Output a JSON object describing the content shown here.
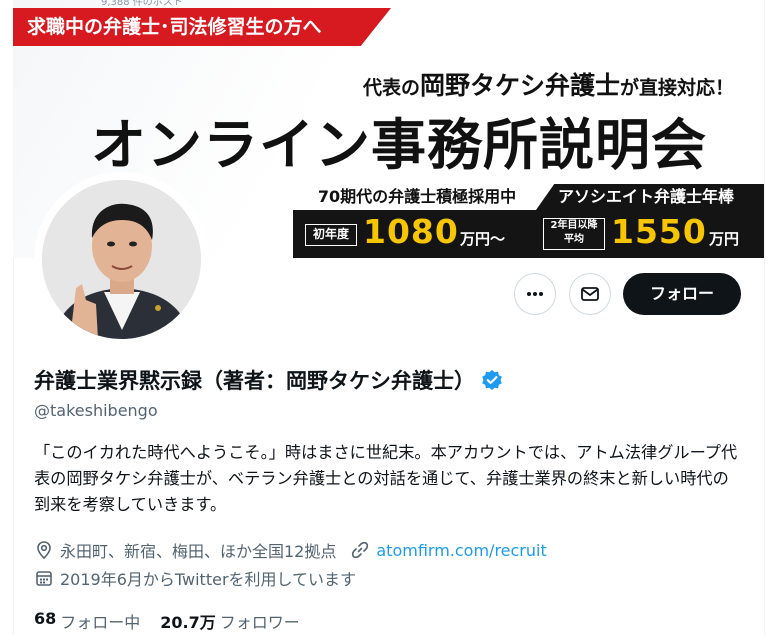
{
  "banner": {
    "cropped_top_text": "9,388 件のポスト",
    "red_tag": "求職中の弁護士･司法修習生の方へ",
    "direct_line_prefix": "代表の",
    "direct_line_name": "岡野タケシ弁護士",
    "direct_line_suffix": "が直接対応！",
    "main_title": "オンライン事務所説明会",
    "recruit_left": "70期代の弁護士積極採用中",
    "recruit_right": "アソシエイト弁護士年棒",
    "salary_first_label": "初年度",
    "salary_first_value": "1080",
    "salary_first_unit": "万円〜",
    "salary_second_label_1": "2年目以降",
    "salary_second_label_2": "平均",
    "salary_second_value": "1550",
    "salary_second_unit": "万円"
  },
  "actions": {
    "more_icon": "more-icon",
    "mail_icon": "mail-icon",
    "follow_label": "フォロー"
  },
  "profile": {
    "name": "弁護士業界黙示録（著者：岡野タケシ弁護士）",
    "handle": "@takeshibengo",
    "bio": "「このイカれた時代へようこそ。」時はまさに世紀末。本アカウントでは、アトム法律グループ代表の岡野タケシ弁護士が、ベテラン弁護士との対話を通じて、弁護士業界の終末と新しい時代の到来を考察していきます。",
    "location": "永田町、新宿、梅田、ほか全国12拠点",
    "url": "atomfirm.com/recruit",
    "joined": "2019年6月からTwitterを利用しています",
    "following_count": "68",
    "following_label": "フォロー中",
    "followers_count": "20.7万",
    "followers_label": "フォロワー"
  },
  "colors": {
    "accent": "#1d9bf0",
    "red": "#d71920",
    "gold": "#f7c600",
    "dark": "#0f1419",
    "muted": "#536471"
  }
}
